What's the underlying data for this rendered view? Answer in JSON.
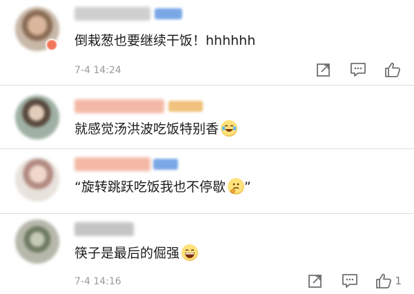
{
  "comments": [
    {
      "text": "倒栽葱也要继续干饭！hhhhhh",
      "timestamp": "7-4 14:24",
      "avatar_color": "#a88a73",
      "username_color": "#c9c9c9",
      "has_vip": true,
      "emoji": "",
      "like_count": ""
    },
    {
      "text": "就感觉汤洪波吃饭特别香",
      "timestamp": "",
      "avatar_color": "#6d6b5f",
      "username_color": "#f4b9a6",
      "has_vip": true,
      "emoji": "laughing-crying-emoji",
      "like_count": ""
    },
    {
      "text": "“旋转跳跃吃饭我也不停歇",
      "text_after": "”",
      "timestamp": "",
      "avatar_color": "#d6b8ae",
      "username_color": "#f4b9a6",
      "has_vip": true,
      "emoji": "thinking-emoji",
      "like_count": ""
    },
    {
      "text": "筷子是最后的倔强",
      "timestamp": "7-4 14:16",
      "avatar_color": "#8d9480",
      "username_color": "#c4c4c4",
      "has_vip": false,
      "emoji": "grinning-emoji",
      "like_count": "1"
    }
  ],
  "icons": {
    "share": "share-icon",
    "comment": "comment-icon",
    "like": "thumbs-up-icon"
  },
  "colors": {
    "text": "#1c1c1c",
    "meta": "#9a9a9a",
    "divider": "#dcdcdc",
    "icon": "#6f6f6f"
  }
}
